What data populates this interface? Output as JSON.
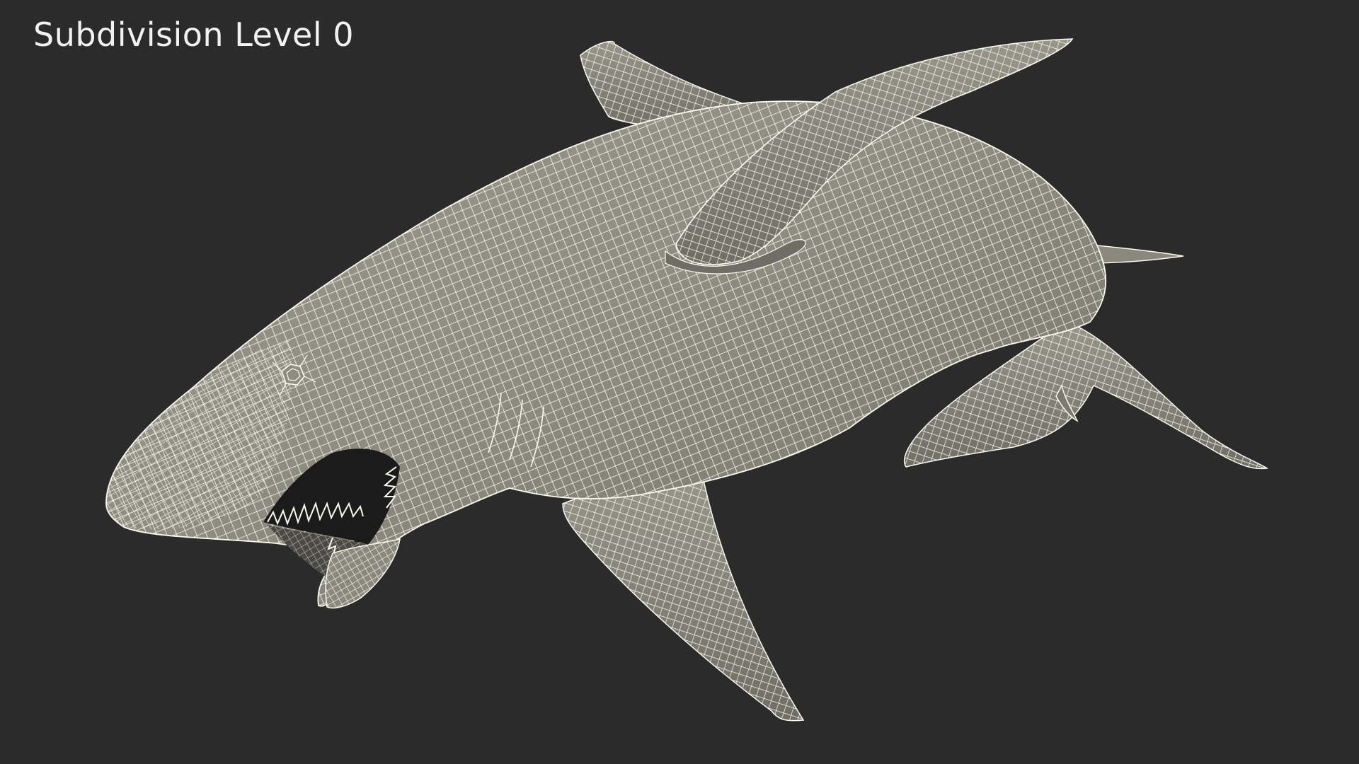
{
  "overlay": {
    "label": "Subdivision Level 0"
  },
  "viewport": {
    "background_color": "#2b2b2b",
    "mesh_fill_color": "#8e8c7f",
    "wire_color": "#fbfbf1",
    "shading": "wireframe-on-shaded"
  },
  "model": {
    "subject": "shark",
    "icon": "shark-wireframe-icon"
  }
}
